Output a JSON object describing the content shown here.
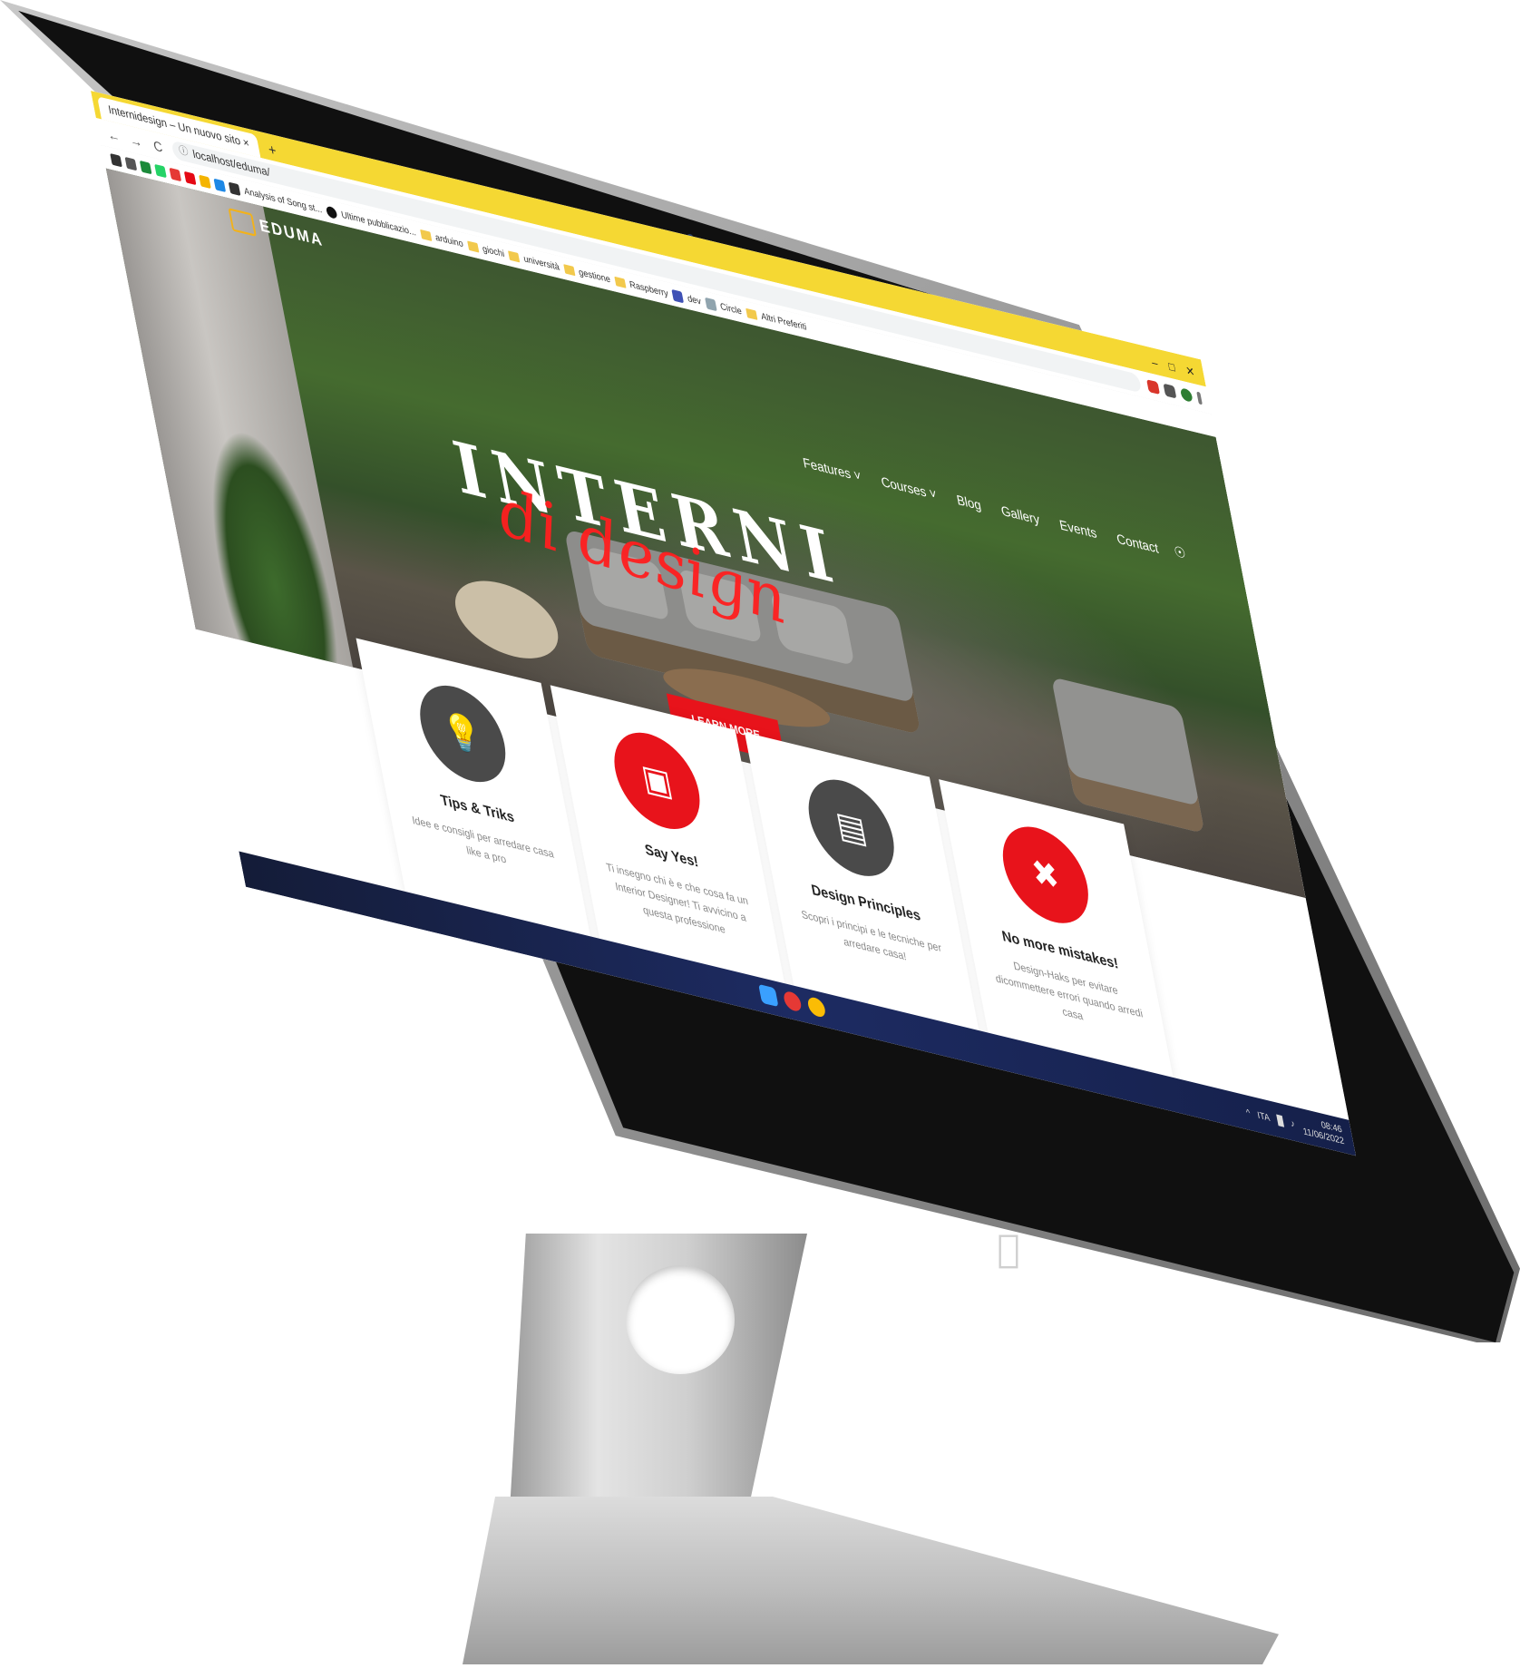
{
  "colors": {
    "accent_yellow": "#f5d833",
    "brand_red": "#e8131b",
    "dark_circle": "#4a4a4a",
    "logo_gold": "#f2b21b"
  },
  "browser": {
    "tab_title": "Internidesign – Un nuovo sito",
    "new_tab_label": "+",
    "url": "localhost/eduma/",
    "bookmark_labels": [
      "Analysis of Song st...",
      "Ultime pubblicazio...",
      "arduino",
      "giochi",
      "università",
      "gestione",
      "Raspberry",
      "dev",
      "Circle",
      "Altri Preferiti"
    ]
  },
  "site": {
    "logo_text": "EDUMA",
    "nav": [
      "Features",
      "Courses",
      "Blog",
      "Gallery",
      "Events",
      "Contact"
    ],
    "hero_title": "INTERNI",
    "hero_script": "di design",
    "cta_label": "LEARN MORE",
    "cards": [
      {
        "icon": "lightbulb-icon",
        "title": "Tips & Triks",
        "text": "Idee e consigli per arredare casa like a pro",
        "color": "#4a4a4a"
      },
      {
        "icon": "monitor-graduate-icon",
        "title": "Say Yes!",
        "text": "Ti insegno chi è e che cosa fa un Interior Designer! Ti avvicino a questa professione",
        "color": "#e8131b"
      },
      {
        "icon": "notepad-icon",
        "title": "Design Principles",
        "text": "Scopri i principi e le tecniche per arredare casa!",
        "color": "#4a4a4a"
      },
      {
        "icon": "close-x-icon",
        "title": "No more mistakes!",
        "text": "Design-Haks per evitare dicommettere errori quando arredi casa",
        "color": "#e8131b"
      }
    ]
  },
  "taskbar": {
    "lang": "ITA",
    "time": "08:46",
    "date": "11/06/2022"
  }
}
